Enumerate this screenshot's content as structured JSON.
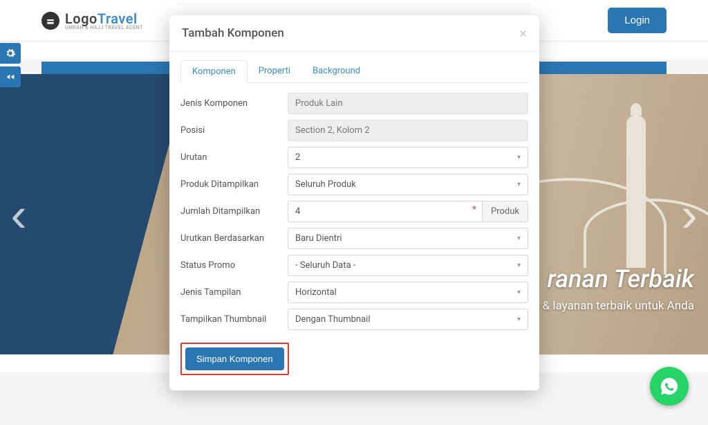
{
  "header": {
    "logo_primary": "Logo",
    "logo_secondary": "Travel",
    "logo_tagline": "UMRAH & HAJJ TRAVEL AGENT",
    "login_label": "Login"
  },
  "hero": {
    "title_fragment": "ranan Terbaik",
    "subtitle": "Garansi harga & layanan terbaik untuk Anda"
  },
  "modal": {
    "title": "Tambah Komponen",
    "tabs": [
      "Komponen",
      "Properti",
      "Background"
    ],
    "active_tab": 0,
    "fields": {
      "jenis_komponen": {
        "label": "Jenis Komponen",
        "value": "Produk Lain"
      },
      "posisi": {
        "label": "Posisi",
        "value": "Section 2, Kolom 2"
      },
      "urutan": {
        "label": "Urutan",
        "value": "2"
      },
      "produk_ditampilkan": {
        "label": "Produk Ditampilkan",
        "value": "Seluruh Produk"
      },
      "jumlah_ditampilkan": {
        "label": "Jumlah Ditampilkan",
        "value": "4",
        "addon": "Produk"
      },
      "urutkan": {
        "label": "Urutkan Berdasarkan",
        "value": "Baru Dientri"
      },
      "status_promo": {
        "label": "Status Promo",
        "value": "- Seluruh Data -"
      },
      "jenis_tampilan": {
        "label": "Jenis Tampilan",
        "value": "Horizontal"
      },
      "thumbnail": {
        "label": "Tampilkan Thumbnail",
        "value": "Dengan Thumbnail"
      }
    },
    "save_label": "Simpan Komponen"
  },
  "glyphs": {
    "plus": "+",
    "close": "×",
    "caret": "▾",
    "arrow_left": "‹",
    "arrow_right": "›"
  }
}
